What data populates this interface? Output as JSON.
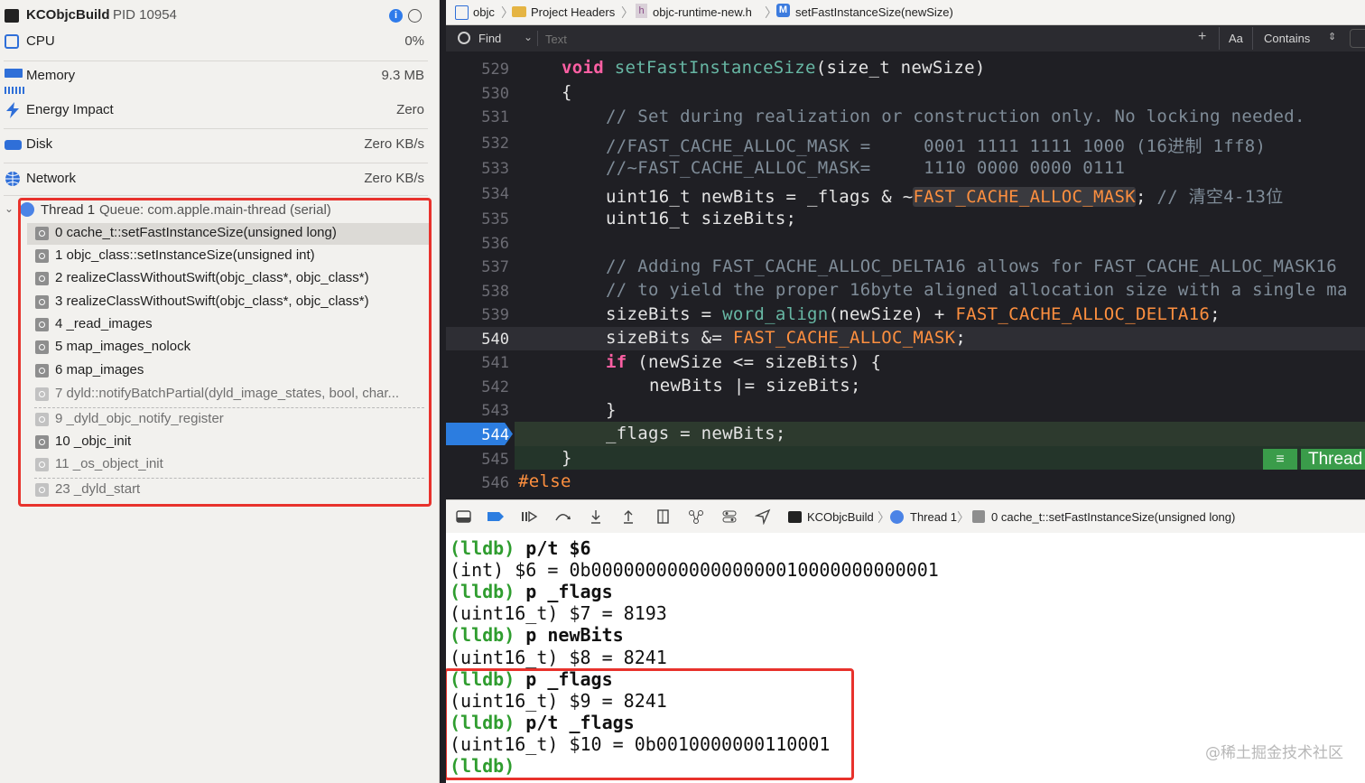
{
  "process": {
    "name": "KCObjcBuild",
    "pid": "PID 10954"
  },
  "gauges": [
    {
      "label": "CPU",
      "value": "0%"
    },
    {
      "label": "Memory",
      "value": "9.3 MB"
    },
    {
      "label": "Energy Impact",
      "value": "Zero"
    },
    {
      "label": "Disk",
      "value": "Zero KB/s"
    },
    {
      "label": "Network",
      "value": "Zero KB/s"
    }
  ],
  "thread": {
    "label": "Thread 1",
    "queue": "Queue: com.apple.main-thread (serial)"
  },
  "frames": [
    "0 cache_t::setFastInstanceSize(unsigned long)",
    "1 objc_class::setInstanceSize(unsigned int)",
    "2 realizeClassWithoutSwift(objc_class*, objc_class*)",
    "3 realizeClassWithoutSwift(objc_class*, objc_class*)",
    "4 _read_images",
    "5 map_images_nolock",
    "6 map_images",
    "7 dyld::notifyBatchPartial(dyld_image_states, bool, char...",
    "9 _dyld_objc_notify_register",
    "10 _objc_init",
    "11 _os_object_init",
    "23 _dyld_start"
  ],
  "jumpbar": [
    "objc",
    "Project Headers",
    "objc-runtime-new.h",
    "setFastInstanceSize(newSize)"
  ],
  "find": {
    "mode": "Find",
    "placeholder": "Text",
    "case_label": "Aa",
    "match": "Contains"
  },
  "line_numbers": [
    "529",
    "530",
    "531",
    "532",
    "533",
    "534",
    "535",
    "536",
    "537",
    "538",
    "539",
    "540",
    "541",
    "542",
    "543",
    "544",
    "545",
    "546"
  ],
  "code": {
    "l529a": "void",
    "l529b": "setFastInstanceSize",
    "l529c": "(size_t newSize)",
    "l530": "{",
    "l531": "// Set during realization or construction only. No locking needed.",
    "l532": "//FAST_CACHE_ALLOC_MASK =     0001 1111 1111 1000 (16进制 1ff8)",
    "l533": "//~FAST_CACHE_ALLOC_MASK=     1110 0000 0000 0111",
    "l534a": "uint16_t newBits = _flags & ~",
    "l534b": "FAST_CACHE_ALLOC_MASK",
    "l534c": ";",
    "l534d": " // 清空4-13位",
    "l535": "uint16_t sizeBits;",
    "l537": "// Adding FAST_CACHE_ALLOC_DELTA16 allows for FAST_CACHE_ALLOC_MASK16",
    "l538": "// to yield the proper 16byte aligned allocation size with a single ma",
    "l539a": "sizeBits = ",
    "l539b": "word_align",
    "l539c": "(newSize) + ",
    "l539d": "FAST_CACHE_ALLOC_DELTA16",
    "l539e": ";",
    "l540a": "sizeBits &= ",
    "l540b": "FAST_CACHE_ALLOC_MASK",
    "l540c": ";",
    "l541a": "if",
    "l541b": " (newSize <= sizeBits) {",
    "l542": "newBits |= sizeBits;",
    "l543": "}",
    "l544": "_flags = newBits;",
    "l545": "}",
    "l546": "#else"
  },
  "thread_badge": "Thread",
  "debug_path": [
    "KCObjcBuild",
    "Thread 1",
    "0 cache_t::setFastInstanceSize(unsigned long)"
  ],
  "console": {
    "l1_prompt": "(lldb)",
    "l1_cmd": " p/t $6",
    "l2": "(int) $6 = 0b00000000000000000010000000000001",
    "l3_prompt": "(lldb)",
    "l3_cmd": " p _flags",
    "l4": "(uint16_t) $7 = 8193",
    "l5_prompt": "(lldb)",
    "l5_cmd": " p newBits",
    "l6": "(uint16_t) $8 = 8241",
    "l7_prompt": "(lldb)",
    "l7_cmd": " p _flags",
    "l8": "(uint16_t) $9 = 8241",
    "l9_prompt": "(lldb)",
    "l9_cmd": " p/t _flags",
    "l10": "(uint16_t) $10 = 0b0010000000110001",
    "l11_prompt": "(lldb)"
  },
  "watermark": "@稀土掘金技术社区",
  "colors": {
    "highlight_red": "#e8322c",
    "breakpoint_blue": "#2c7de0",
    "lldb_green": "#2f9d2f"
  }
}
